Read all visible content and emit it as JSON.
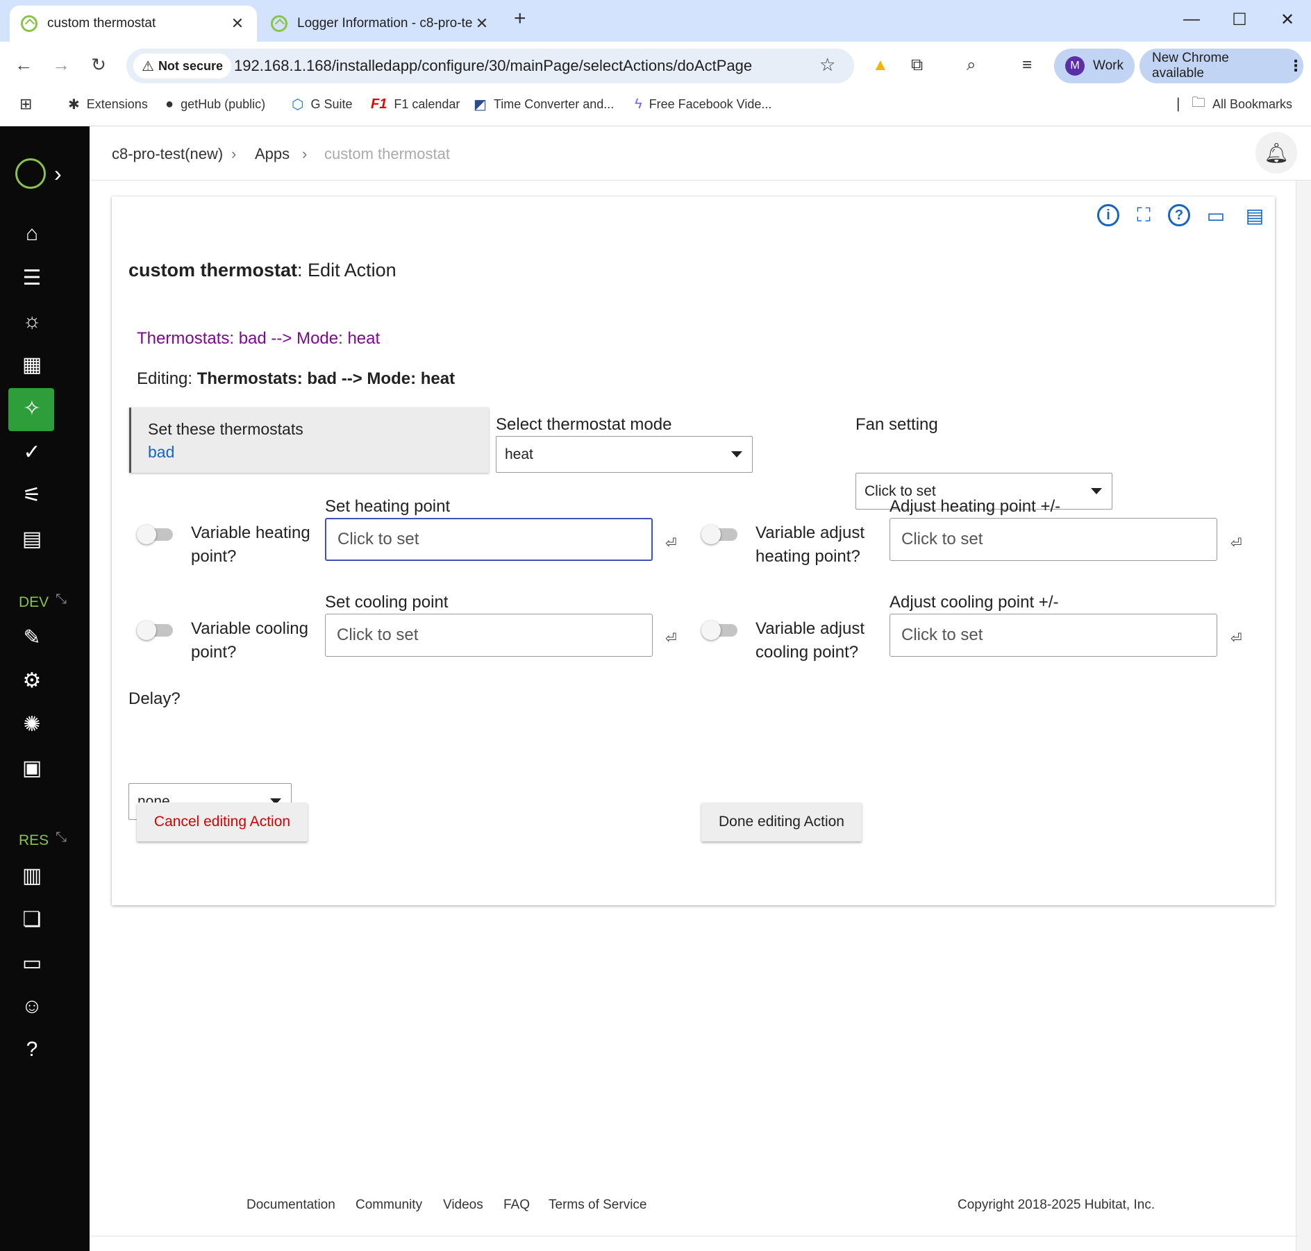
{
  "browser": {
    "tabs": [
      {
        "label": "custom thermostat",
        "active": true
      },
      {
        "label": "Logger Information - c8-pro-te",
        "active": false
      }
    ],
    "not_secure_label": "Not secure",
    "url": "192.168.1.168/installedapp/configure/30/mainPage/selectActions/doActPage",
    "profile_initial": "M",
    "profile_label": "Work",
    "update_label": "New Chrome available",
    "bookmarks": [
      "Extensions",
      "getHub (public)",
      "G Suite",
      "F1 calendar",
      "Time Converter and...",
      "Free Facebook Vide..."
    ],
    "all_bookmarks_label": "All Bookmarks"
  },
  "sidebar": {
    "dev_label": "DEV",
    "res_label": "RES",
    "icons": [
      "home-icon",
      "rooms-icon",
      "devices-icon",
      "dashboards-icon",
      "apps-icon",
      "rule-check-icon",
      "settings-sliders-icon",
      "logs-icon",
      "apps-code-icon",
      "drivers-code-icon",
      "libraries-icon",
      "bundles-icon",
      "documentation-icon",
      "community-icon",
      "videos-icon",
      "bot-icon",
      "support-icon"
    ]
  },
  "breadcrumb": {
    "hub": "c8-pro-test(new)",
    "apps": "Apps",
    "current": "custom thermostat"
  },
  "page": {
    "title_bold": "custom thermostat",
    "title_rest": ": Edit Action",
    "subtitle": "Thermostats: bad --> Mode: heat",
    "editing_prefix": "Editing: ",
    "editing_value": "Thermostats: bad --> Mode: heat"
  },
  "form": {
    "thermostats_label": "Set these thermostats",
    "thermostats_value": "bad",
    "mode_label": "Select thermostat mode",
    "mode_value": "heat",
    "fan_label": "Fan setting",
    "fan_value": "Click to set",
    "var_heating_label": "Variable heating point?",
    "set_heating_label": "Set heating point",
    "set_heating_placeholder": "Click to set",
    "var_adj_heating_label": "Variable adjust heating point?",
    "adj_heating_label": "Adjust heating point +/-",
    "adj_heating_placeholder": "Click to set",
    "var_cooling_label": "Variable cooling point?",
    "set_cooling_label": "Set cooling point",
    "set_cooling_placeholder": "Click to set",
    "var_adj_cooling_label": "Variable adjust cooling point?",
    "adj_cooling_label": "Adjust cooling point +/-",
    "adj_cooling_placeholder": "Click to set",
    "delay_label": "Delay?",
    "delay_value": "none",
    "cancel_label": "Cancel editing Action",
    "done_label": "Done editing Action",
    "enter_glyph": "⏎"
  },
  "footer": {
    "links": [
      "Documentation",
      "Community",
      "Videos",
      "FAQ",
      "Terms of Service"
    ],
    "copyright": "Copyright 2018-2025 Hubitat, Inc."
  },
  "colors": {
    "accent_green": "#8bc34a",
    "active_nav": "#2e9e3a",
    "link_blue": "#1565c0",
    "subtitle_purple": "#7a0a8c",
    "cancel_red": "#d50000"
  }
}
